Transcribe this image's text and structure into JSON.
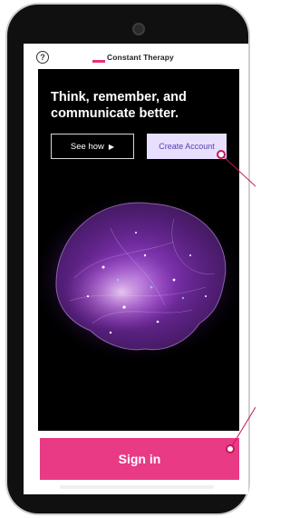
{
  "header": {
    "help_icon_glyph": "?",
    "brand_name": "Constant Therapy",
    "brand_accent_color": "#e8327a"
  },
  "hero": {
    "headline": "Think, remember, and communicate better.",
    "see_how_label": "See how",
    "see_how_icon": "play-icon",
    "create_account_label": "Create Account",
    "image": "glowing-brain-illustration"
  },
  "footer": {
    "sign_in_label": "Sign in",
    "sign_in_color": "#e93a86"
  },
  "callouts": {
    "color": "#c2185b"
  }
}
